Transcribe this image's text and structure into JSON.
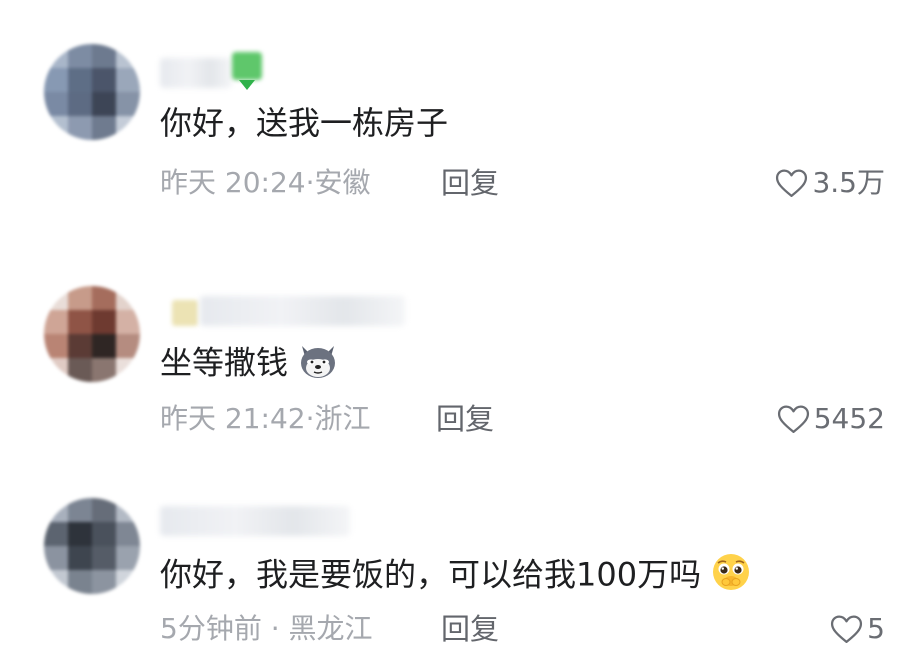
{
  "comments": [
    {
      "text": "你好，送我一栋房子",
      "time": "昨天 20:24",
      "location": "安徽",
      "reply_label": "回复",
      "likes": "3.5万"
    },
    {
      "text": "坐等撒钱",
      "emoji": "dog-emoji",
      "time": "昨天 21:42",
      "location": "浙江",
      "reply_label": "回复",
      "likes": "5452"
    },
    {
      "text": "你好，我是要饭的，可以给我100万吗",
      "emoji": "pleading-face-emoji",
      "time": "5分钟前",
      "location": "黑龙江",
      "reply_label": "回复",
      "likes": "5"
    }
  ],
  "colors": {
    "text": "#1e1f21",
    "meta": "#a5a8ae",
    "reply": "#63666c",
    "likes": "#6a6d73",
    "badge_green": "#5fc76b"
  }
}
